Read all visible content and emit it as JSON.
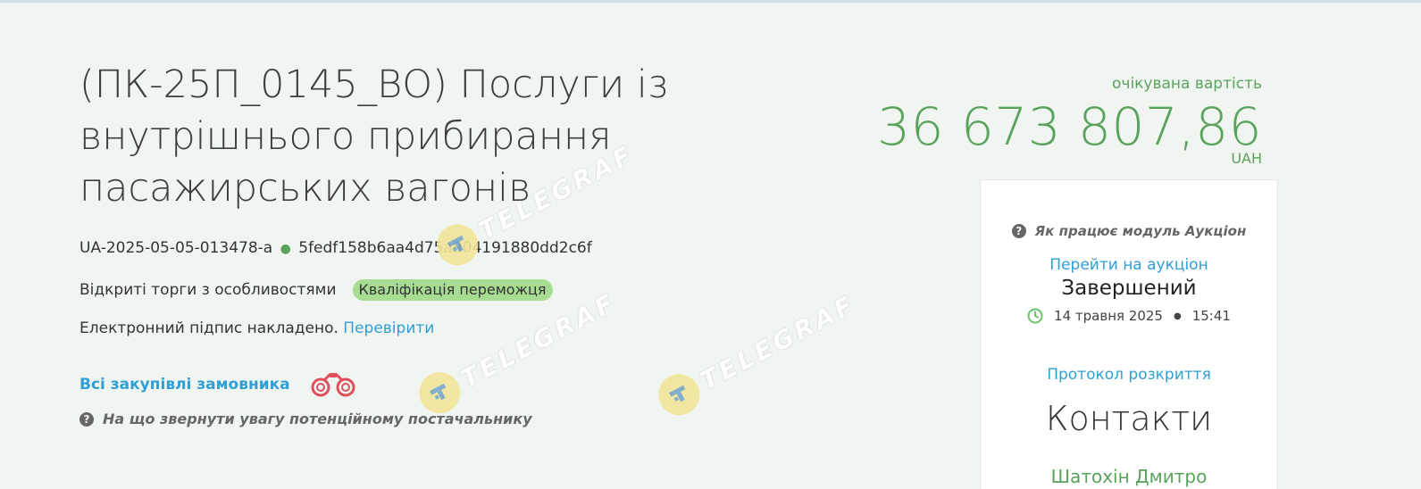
{
  "tender": {
    "title": "(ПК-25П_0145_ВО) Послуги із внутрішнього прибирання пасажирських вагонів",
    "tender_id": "UA-2025-05-05-013478-a",
    "hash": "5fedf158b6aa4d75a904191880dd2c6f",
    "procedure_type": "Відкриті торги з особливостями",
    "status_badge": "Кваліфікація переможця",
    "signature_text": "Електронний підпис накладено.",
    "verify_link": "Перевірити",
    "all_purchases_link": "Всі закупівлі замовника",
    "supplier_hint": "На що звернути увагу потенційному постачальнику"
  },
  "value": {
    "label": "очікувана вартість",
    "amount": "36 673 807,86",
    "currency": "UAH"
  },
  "auction": {
    "how_it_works": "Як працює модуль Аукціон",
    "go_link": "Перейти на аукціон",
    "status": "Завершений",
    "date": "14 травня 2025",
    "time": "15:41",
    "protocol_link": "Протокол розкриття"
  },
  "contacts": {
    "title": "Контакти",
    "name": "Шатохін Дмитро"
  },
  "watermark": {
    "text": "TELEGRAF"
  },
  "colors": {
    "accent_green": "#5aa35c",
    "link_blue": "#2f9fd4",
    "badge_green": "#a6dd92",
    "background": "#f1f5f2"
  },
  "icons": [
    "question-circle-icon",
    "binoculars-icon",
    "clock-icon",
    "telegraf-logo-icon"
  ]
}
